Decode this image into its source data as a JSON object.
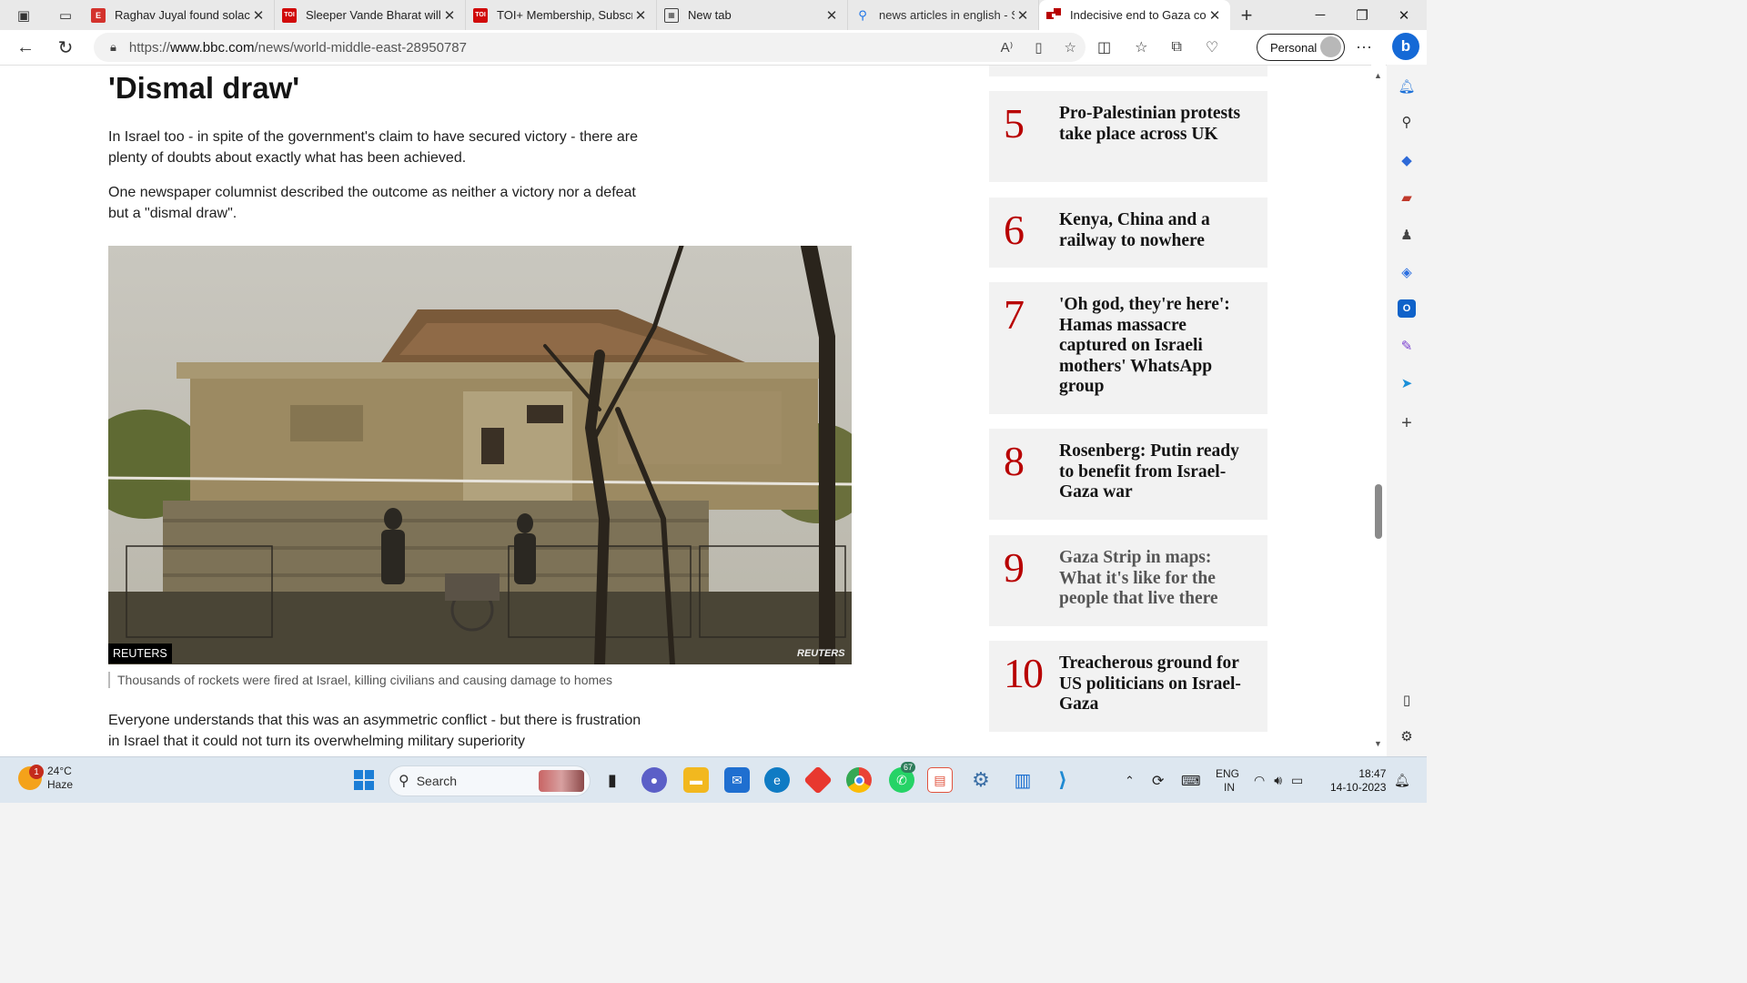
{
  "tabs": [
    {
      "title": "Raghav Juyal found solace",
      "favicon": "E",
      "favicon_color": "#d3322c"
    },
    {
      "title": "Sleeper Vande Bharat will c",
      "favicon": "TOI",
      "favicon_color": "#d10a0a"
    },
    {
      "title": "TOI+ Membership, Subscri",
      "favicon": "TOI",
      "favicon_color": "#d10a0a"
    },
    {
      "title": "New tab",
      "favicon": "newtab-icon",
      "favicon_color": "#444"
    },
    {
      "title": "news articles in english - S",
      "favicon": "search-icon",
      "favicon_color": "#1a73e8"
    },
    {
      "title": "Indecisive end to Gaza cor",
      "favicon": "bbc-icon",
      "favicon_color": "#b80000"
    }
  ],
  "address": {
    "scheme": "https://",
    "host": "www.bbc.com",
    "path": "/news/world-middle-east-28950787"
  },
  "profile": {
    "label": "Personal"
  },
  "article": {
    "heading": "'Dismal draw'",
    "para1": "In Israel too - in spite of the government's claim to have secured victory - there are plenty of doubts about exactly what has been achieved.",
    "para2": "One newspaper columnist described the outcome as neither a victory nor a defeat but a \"dismal draw\".",
    "image_credit": "REUTERS",
    "image_watermark": "REUTERS",
    "caption": "Thousands of rockets were fired at Israel, killing civilians and causing damage to homes",
    "para3": "Everyone understands that this was an asymmetric conflict - but there is frustration in Israel that it could not turn its overwhelming military superiority"
  },
  "most_read": [
    {
      "num": "5",
      "text": "Pro-Palestinian protests take place across UK",
      "visited": false
    },
    {
      "num": "6",
      "text": "Kenya, China and a railway to nowhere",
      "visited": false
    },
    {
      "num": "7",
      "text": "'Oh god, they're here': Hamas massacre captured on Israeli mothers' WhatsApp group",
      "visited": false
    },
    {
      "num": "8",
      "text": "Rosenberg: Putin ready to benefit from Israel-Gaza war",
      "visited": false
    },
    {
      "num": "9",
      "text": "Gaza Strip in maps: What it's like for the people that live there",
      "visited": true
    },
    {
      "num": "10",
      "text": "Treacherous ground for US politicians on Israel-Gaza",
      "visited": false
    }
  ],
  "taskbar": {
    "weather_temp": "24°C",
    "weather_desc": "Haze",
    "weather_badge": "1",
    "search_label": "Search",
    "whatsapp_badge": "67",
    "lang_top": "ENG",
    "lang_bottom": "IN",
    "time": "18:47",
    "date": "14-10-2023"
  }
}
